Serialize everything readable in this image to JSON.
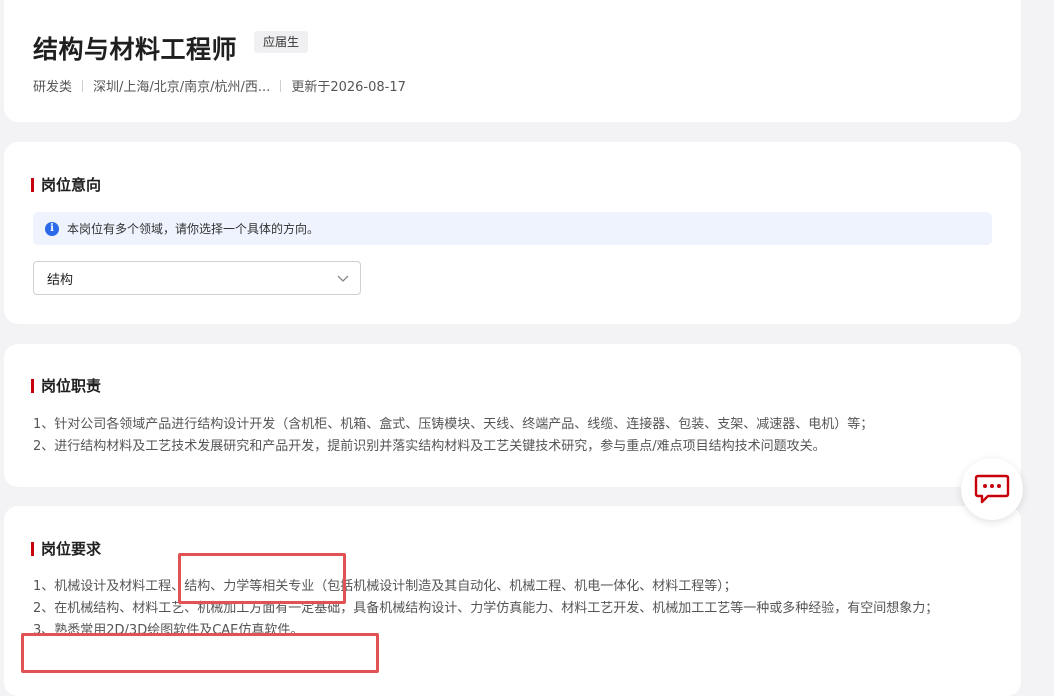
{
  "header": {
    "title": "结构与材料工程师",
    "tag": "应届生",
    "category": "研发类",
    "locations": "深圳/上海/北京/南京/杭州/西...",
    "updated": "更新于2026-08-17"
  },
  "intent": {
    "title": "岗位意向",
    "notice": "本岗位有多个领域，请你选择一个具体的方向。",
    "select_value": "结构"
  },
  "duty": {
    "title": "岗位职责",
    "lines": [
      "1、针对公司各领域产品进行结构设计开发（含机柜、机箱、盒式、压铸模块、天线、终端产品、线缆、连接器、包装、支架、减速器、电机）等；",
      "2、进行结构材料及工艺技术发展研究和产品开发，提前识别并落实结构材料及工艺关键技术研究，参与重点/难点项目结构技术问题攻关。"
    ]
  },
  "requirements": {
    "title": "岗位要求",
    "lines": [
      "1、机械设计及材料工程、结构、力学等相关专业（包括机械设计制造及其自动化、机械工程、机电一体化、材料工程等）；",
      "2、在机械结构、材料工艺、机械加工方面有一定基础，具备机械结构设计、力学仿真能力、材料工艺开发、机械加工工艺等一种或多种经验，有空间想象力；",
      "3、熟悉常用2D/3D绘图软件及CAE仿真软件。"
    ]
  },
  "icons": {
    "info": "info-icon",
    "chevron": "chevron-down-icon",
    "chat": "chat-icon"
  },
  "colors": {
    "accent": "#c7000b",
    "info_blue": "#2a6ae8",
    "highlight": "#e35252"
  }
}
